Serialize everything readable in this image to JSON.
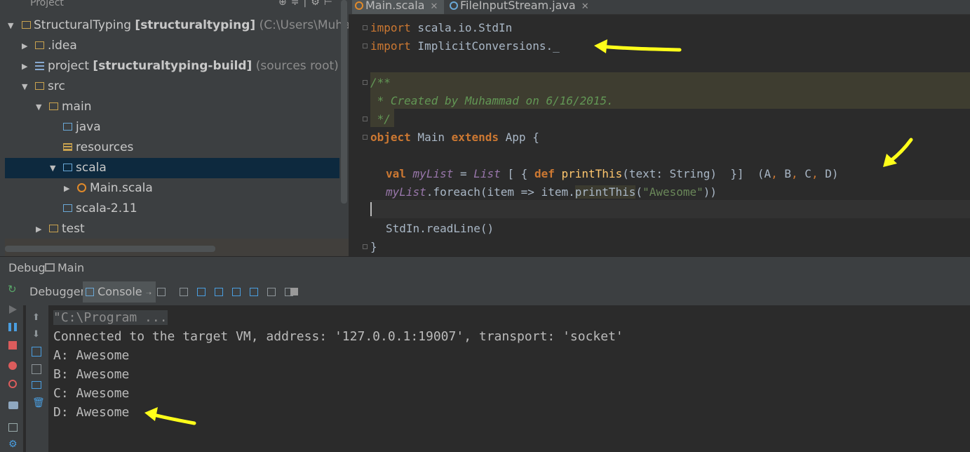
{
  "project": {
    "header_title": "Project",
    "tree": [
      {
        "label": "StructuralTyping",
        "bold": "[structuraltyping]",
        "extra": "(C:\\Users\\Muhammad"
      },
      {
        "label": ".idea"
      },
      {
        "label": "project",
        "bold": "[structuraltyping-build]",
        "extra": "(sources root)"
      },
      {
        "label": "src"
      },
      {
        "label": "main"
      },
      {
        "label": "java"
      },
      {
        "label": "resources"
      },
      {
        "label": "scala"
      },
      {
        "label": "Main.scala"
      },
      {
        "label": "scala-2.11"
      },
      {
        "label": "test"
      }
    ]
  },
  "editor": {
    "tabs": [
      {
        "label": "Main.scala"
      },
      {
        "label": "FileInputStream.java"
      }
    ],
    "code": {
      "l1_kw": "import",
      "l1_rest": " scala.io.StdIn",
      "l2_kw": "import",
      "l2_rest": " ImplicitConversions._",
      "l4": "/**",
      "l5": " * Created by Muhammad on 6/16/2015.",
      "l6": " */",
      "l7_kw1": "object",
      "l7_a": " Main ",
      "l7_kw2": "extends",
      "l7_b": " App {",
      "l9_kw": "val",
      "l9_field": "myList",
      "l9_a": " = ",
      "l9_type": "List",
      "l9_b": " [ { ",
      "l9_def": "def",
      "l9_fn": "printThis",
      "l9_c": "(text: String)  }]  (A",
      "l9_comma1": ",",
      "l9_d": " B",
      "l9_comma2": ",",
      "l9_e": " C",
      "l9_comma3": ",",
      "l9_f": " D)",
      "l10_field": "myList",
      "l10_a": ".foreach(item => item.",
      "l10_fn": "printThis",
      "l10_b": "(",
      "l10_str": "\"Awesome\"",
      "l10_c": "))",
      "l12": "StdIn.readLine()",
      "l13": "}"
    }
  },
  "debug": {
    "title": "Debug",
    "config": "Main",
    "tab_debugger": "Debugger",
    "tab_console": "Console",
    "console_lines": [
      "\"C:\\Program ...",
      "Connected to the target VM, address: '127.0.0.1:19007', transport: 'socket'",
      "A: Awesome",
      "B: Awesome",
      "C: Awesome",
      "D: Awesome"
    ]
  },
  "colors": {
    "annotation_arrow": "#ffff1a",
    "keyword": "#cc7832",
    "doc_comment": "#629755",
    "string": "#6a8759"
  },
  "icons": [
    "project-icon",
    "gear-icon",
    "folder-icon",
    "module-icon",
    "scala-object-icon",
    "rerun-icon",
    "resume-icon",
    "pause-icon",
    "stop-icon",
    "breakpoints-icon",
    "mute-icon",
    "camera-icon",
    "settings-icon",
    "step-over-icon",
    "step-into-icon",
    "step-out-icon",
    "up-icon",
    "down-icon",
    "print-icon",
    "trash-icon"
  ]
}
